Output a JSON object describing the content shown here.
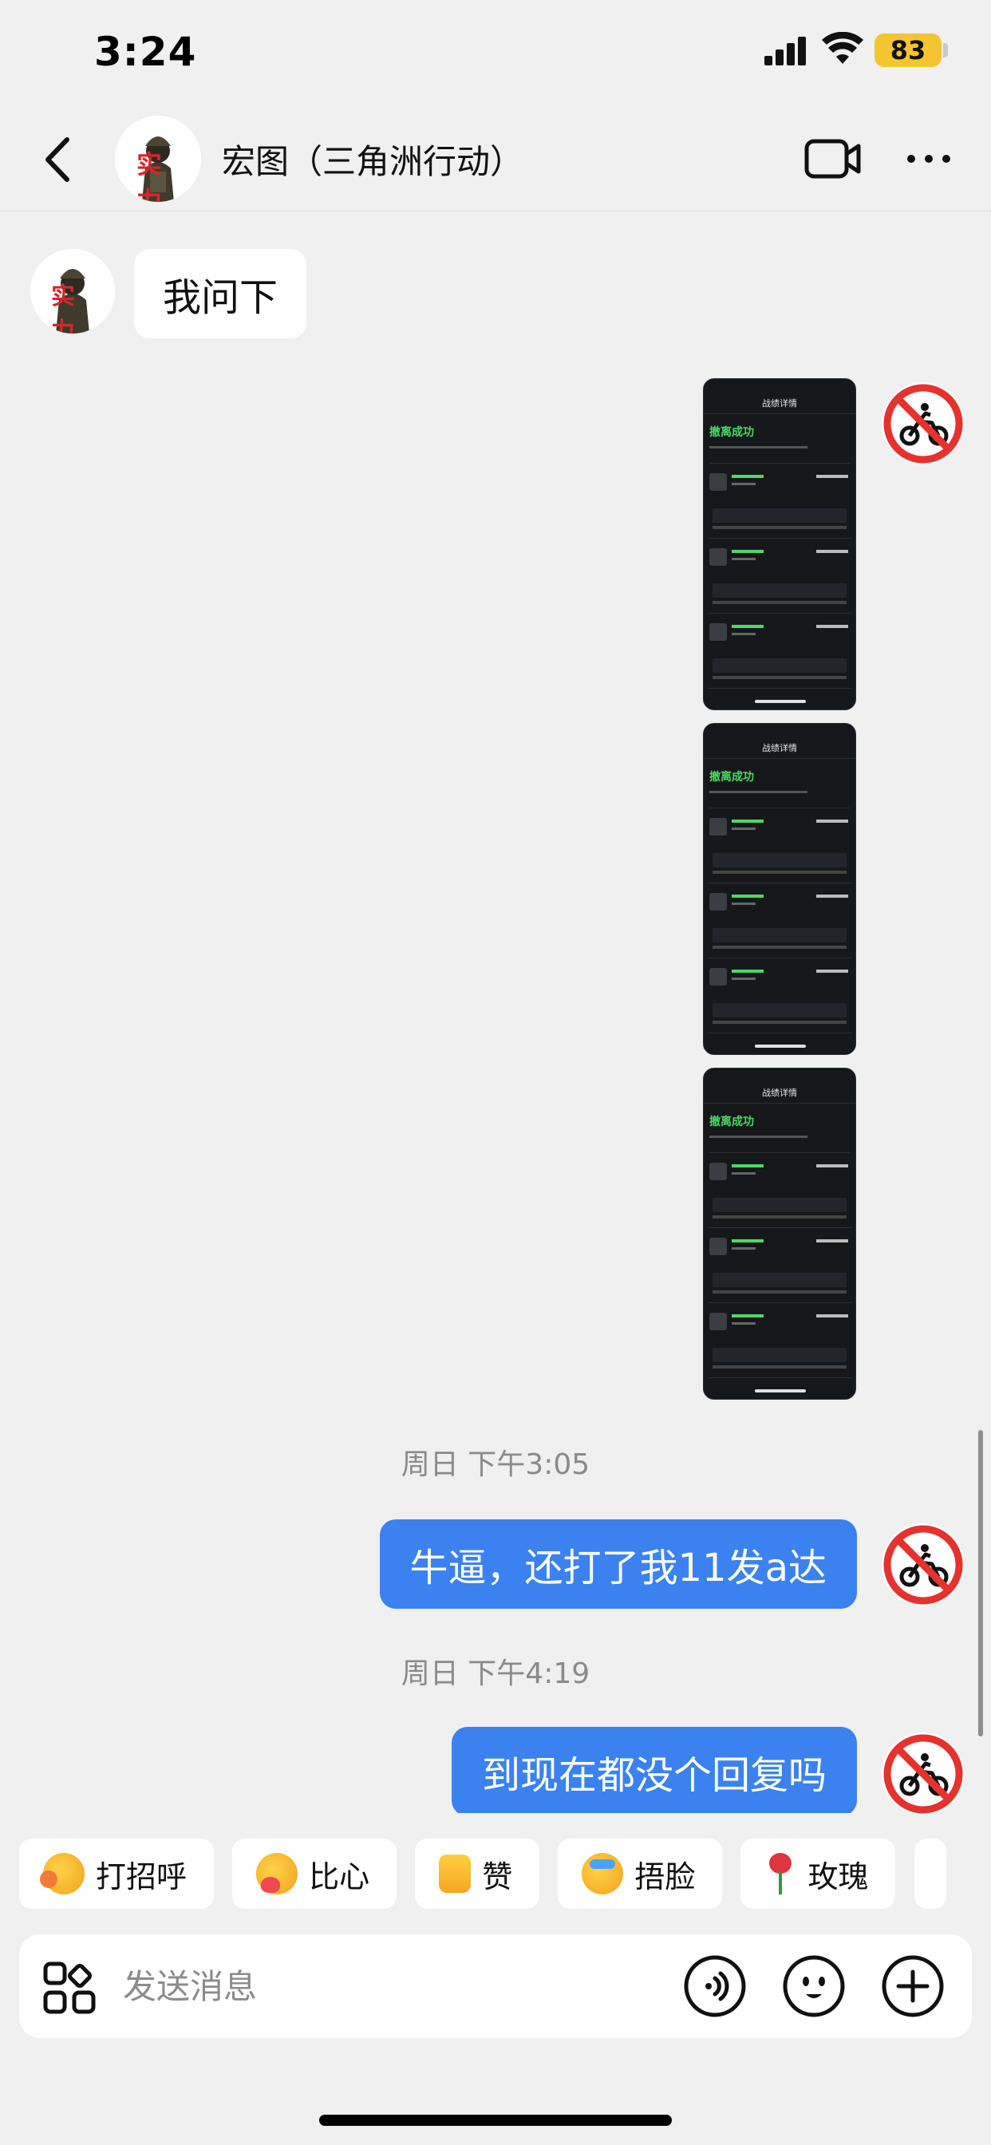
{
  "status_bar": {
    "time": "3:24",
    "battery": "83"
  },
  "header": {
    "title": "宏图（三角洲行动）",
    "avatar_text": "实力"
  },
  "messages": {
    "incoming_1": "我问下",
    "timestamp_1": "周日 下午3:05",
    "outgoing_1": "牛逼，还打了我11发a达",
    "timestamp_2": "周日 下午4:19",
    "outgoing_2": "到现在都没个回复吗"
  },
  "thumbs": [
    {
      "nav_title": "战绩详情",
      "result": "撤离成功"
    },
    {
      "nav_title": "战绩详情",
      "result": "撤离成功"
    },
    {
      "nav_title": "战绩详情",
      "result": "撤离成功"
    }
  ],
  "quick_replies": [
    {
      "label": "打招呼",
      "icon": "wave-emoji-icon"
    },
    {
      "label": "比心",
      "icon": "heart-hands-emoji-icon"
    },
    {
      "label": "赞",
      "icon": "thumbs-up-icon"
    },
    {
      "label": "捂脸",
      "icon": "facepalm-emoji-icon"
    },
    {
      "label": "玫瑰",
      "icon": "rose-icon"
    }
  ],
  "input": {
    "placeholder": "发送消息"
  },
  "colors": {
    "outgoing_bubble": "#3b82f0",
    "accent_green": "#4cd964",
    "battery": "#f4c531"
  }
}
